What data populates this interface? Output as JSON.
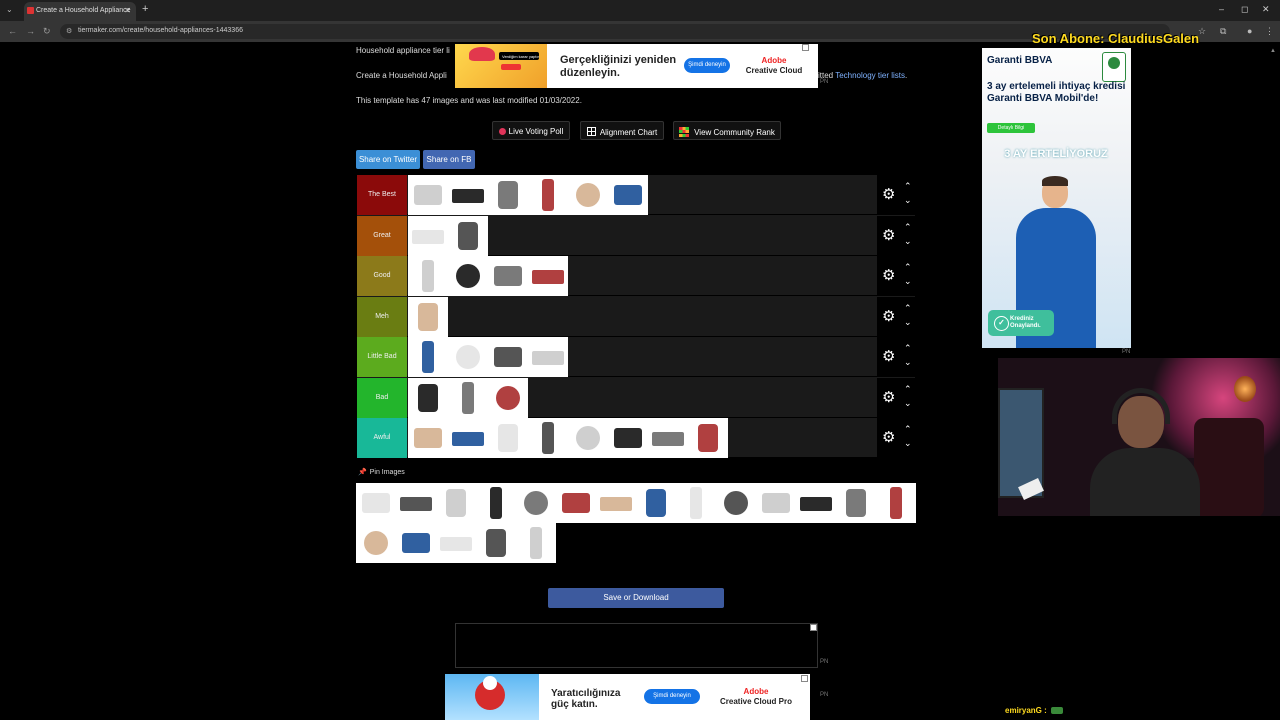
{
  "browser": {
    "tab_title": "Create a Household Appliance",
    "url": "tiermaker.com/create/household-appliances-1443366"
  },
  "page": {
    "heading_partial": "Household appliance tier li",
    "intro_partial": "Create a Household Appli",
    "intro_end": "itted",
    "intro_link": "Technology tier lists",
    "meta": "This template has 47 images and was last modified 01/03/2022.",
    "buttons": {
      "voting": "Live Voting Poll",
      "alignment": "Alignment Chart",
      "community": "View Community Rank",
      "twitter": "Share on Twitter",
      "fb": "Share on FB"
    },
    "tiers": [
      {
        "label": "The Best",
        "color": "#8b0a0a",
        "count": 6
      },
      {
        "label": "Great",
        "color": "#a4500a",
        "count": 2
      },
      {
        "label": "Good",
        "color": "#8c7a1a",
        "count": 4
      },
      {
        "label": "Meh",
        "color": "#6a7d12",
        "count": 1
      },
      {
        "label": "Little Bad",
        "color": "#5cab1e",
        "count": 4
      },
      {
        "label": "Bad",
        "color": "#23b52c",
        "count": 3
      },
      {
        "label": "Awful",
        "color": "#18b898",
        "count": 8
      }
    ],
    "pin_images": "Pin Images",
    "pool_counts": [
      14,
      5
    ],
    "save": "Save or Download"
  },
  "ads": {
    "top": {
      "pill": "Verdiğim karar yaptım",
      "headline": "Gerçekliğinizi yeniden düzenleyin.",
      "cta": "Şimdi deneyin",
      "brand_1": "Adobe",
      "brand_2": "Creative Cloud"
    },
    "bottom": {
      "headline": "Yaratıcılığınıza güç katın.",
      "cta": "Şimdi deneyin",
      "brand_1": "Adobe",
      "brand_2": "Creative Cloud Pro"
    },
    "side": {
      "logo": "Garanti BBVA",
      "headline": "3 ay ertelemeli ihtiyaç kredisi Garanti BBVA Mobil'de!",
      "cta": "Detaylı Bilgi",
      "banner": "3 AY ERTELİYORUZ",
      "badge": "Krediniz Onaylandı."
    },
    "pn": "PN"
  },
  "stream": {
    "subscriber": "Son Abone: ClaudiusGalen",
    "chat_user": "emiryanG :"
  },
  "item_palette": [
    "#cfcfcf",
    "#2a2a2a",
    "#7a7a7a",
    "#b04040",
    "#d8b89a",
    "#3060a0",
    "#e6e6e6",
    "#555"
  ]
}
